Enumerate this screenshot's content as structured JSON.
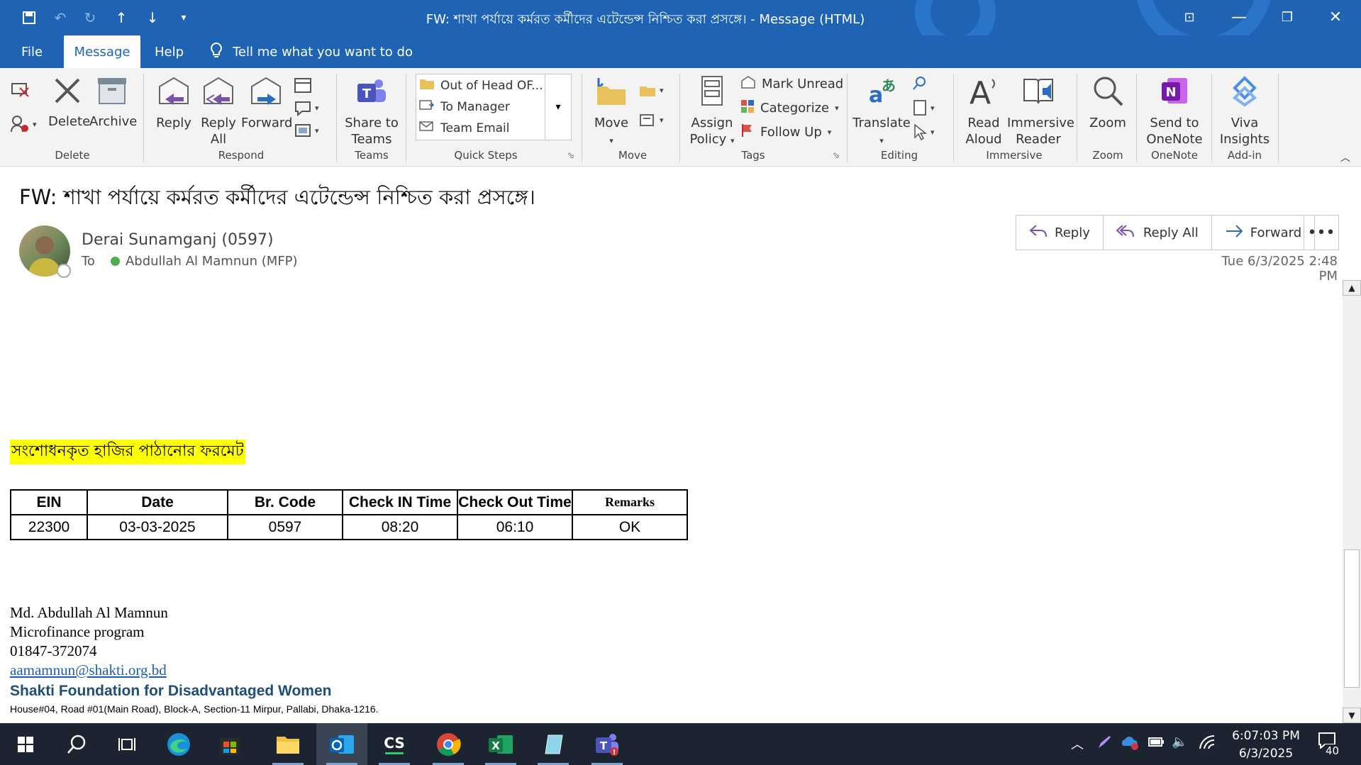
{
  "window": {
    "title": "FW: শাখা পর্যায়ে কর্মরত কর্মীদের এটেন্ডেন্স নিশ্চিত করা প্রসঙ্গে।  -  Message (HTML)"
  },
  "menu": {
    "items": [
      {
        "label": "File",
        "active": false
      },
      {
        "label": "Message",
        "active": true
      },
      {
        "label": "Help",
        "active": false
      }
    ],
    "tell_me": "Tell me what you want to do"
  },
  "ribbon": {
    "groups": {
      "delete": "Delete",
      "respond": "Respond",
      "teams": "Teams",
      "quick_steps": "Quick Steps",
      "move": "Move",
      "tags": "Tags",
      "editing": "Editing",
      "immersive": "Immersive",
      "zoom": "Zoom",
      "onenote": "OneNote",
      "addin": "Add-in"
    },
    "buttons": {
      "delete": "Delete",
      "archive": "Archive",
      "reply": "Reply",
      "reply_all_1": "Reply",
      "reply_all_2": "All",
      "forward": "Forward",
      "share_teams_1": "Share to",
      "share_teams_2": "Teams",
      "move": "Move",
      "assign_policy_1": "Assign",
      "assign_policy_2": "Policy",
      "mark_unread": "Mark Unread",
      "categorize": "Categorize",
      "follow_up": "Follow Up",
      "translate": "Translate",
      "read_aloud_1": "Read",
      "read_aloud_2": "Aloud",
      "immersive_reader_1": "Immersive",
      "immersive_reader_2": "Reader",
      "zoom": "Zoom",
      "send_onenote_1": "Send to",
      "send_onenote_2": "OneNote",
      "viva_1": "Viva",
      "viva_2": "Insights"
    },
    "quick_steps": [
      "Out of Head OF...",
      "To Manager",
      "Team Email"
    ]
  },
  "message": {
    "subject": "FW: শাখা পর্যায়ে কর্মরত কর্মীদের এটেন্ডেন্স নিশ্চিত করা প্রসঙ্গে।",
    "sender": "Derai Sunamganj (0597)",
    "to_label": "To",
    "recipient": "Abdullah Al Mamnun (MFP)",
    "datetime": "Tue 6/3/2025 2:48 PM",
    "actions": {
      "reply": "Reply",
      "reply_all": "Reply All",
      "forward": "Forward"
    }
  },
  "body": {
    "highlight": "সংশোধনকৃত হাজির পাঠানোর ফরমেট",
    "table": {
      "headers": [
        "EIN",
        "Date",
        "Br. Code",
        "Check IN Time",
        "Check Out Time",
        "Remarks"
      ],
      "rows": [
        [
          "22300",
          "03-03-2025",
          "0597",
          "08:20",
          "06:10",
          "OK"
        ]
      ]
    },
    "signature": {
      "name": "Md. Abdullah Al Mamnun",
      "program": "Microfinance program",
      "phone": "01847-372074",
      "email": "aamamnun@shakti.org.bd",
      "org": "Shakti Foundation for Disadvantaged Women",
      "address": "House#04, Road #01(Main Road), Block-A, Section-11 Mirpur, Pallabi, Dhaka-1216."
    }
  },
  "taskbar": {
    "time": "6:07:03 PM",
    "date": "6/3/2025",
    "notification_count": "40",
    "apps": [
      "start-icon",
      "search-icon",
      "task-view-icon",
      "edge-icon",
      "store-icon",
      "file-explorer-icon",
      "outlook-icon",
      "cs-app-icon",
      "chrome-icon",
      "excel-icon",
      "notepad-icon",
      "teams-icon"
    ]
  },
  "colors": {
    "accent": "#1f63b5",
    "highlight": "#ffff00",
    "taskbar": "#1c2431"
  }
}
